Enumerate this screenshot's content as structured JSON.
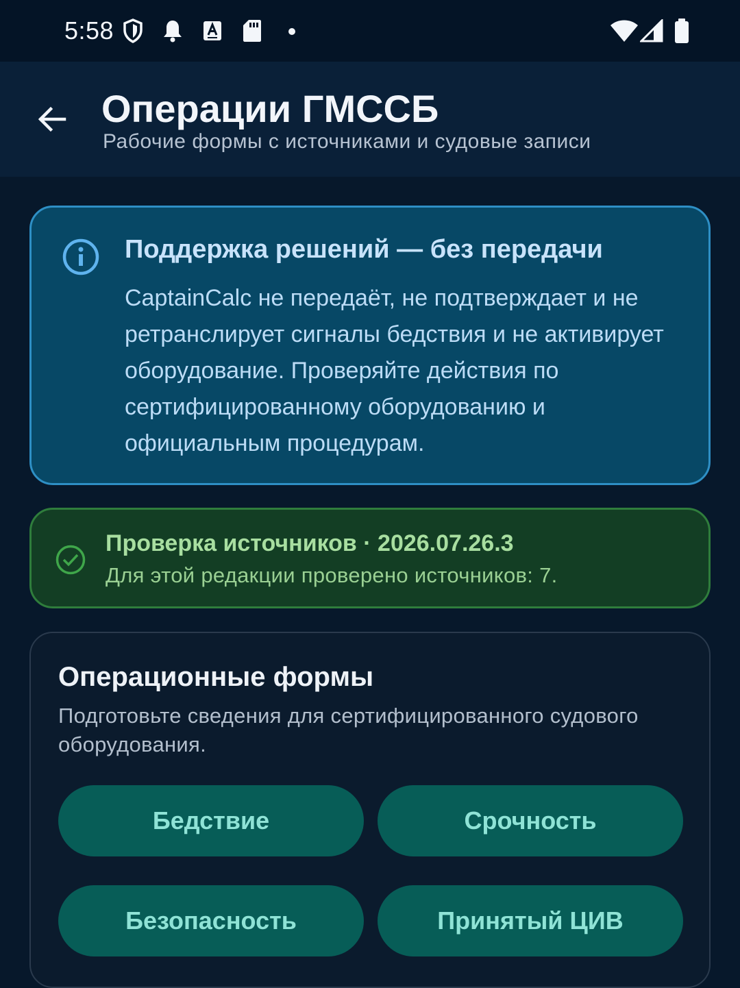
{
  "status_bar": {
    "time": "5:58",
    "icons": [
      "shield-icon",
      "notification-bell-icon",
      "keyboard-a-icon",
      "sd-card-icon",
      "dot-icon",
      "wifi-icon",
      "cell-signal-icon",
      "battery-icon"
    ]
  },
  "app_bar": {
    "back_icon": "arrow-left-icon",
    "title": "Операции ГМССБ",
    "subtitle": "Рабочие формы с источниками и судовые записи"
  },
  "info_card": {
    "icon": "info-icon",
    "title": "Поддержка решений — без передачи",
    "body": "CaptainCalc не передаёт, не подтверждает и не ретранслирует сигналы бедствия и не активирует оборудование. Проверяйте действия по сертифицированному оборудованию и официальным процедурам."
  },
  "source_card": {
    "icon": "check-circle-icon",
    "title": "Проверка источников · 2026.07.26.3",
    "body": "Для этой редакции проверено источников: 7."
  },
  "forms_card": {
    "title": "Операционные формы",
    "subtitle": "Подготовьте сведения для сертифицированного судового оборудования.",
    "buttons": [
      {
        "label": "Бедствие"
      },
      {
        "label": "Срочность"
      },
      {
        "label": "Безопасность"
      },
      {
        "label": "Принятый ЦИВ"
      }
    ]
  },
  "colors": {
    "background": "#07182b",
    "info_card_bg": "#074866",
    "info_card_border": "#2e8fc5",
    "source_card_bg": "#133e24",
    "source_card_border": "#2f7d3c",
    "button_bg": "#075d57",
    "button_text": "#8fe3d6"
  }
}
